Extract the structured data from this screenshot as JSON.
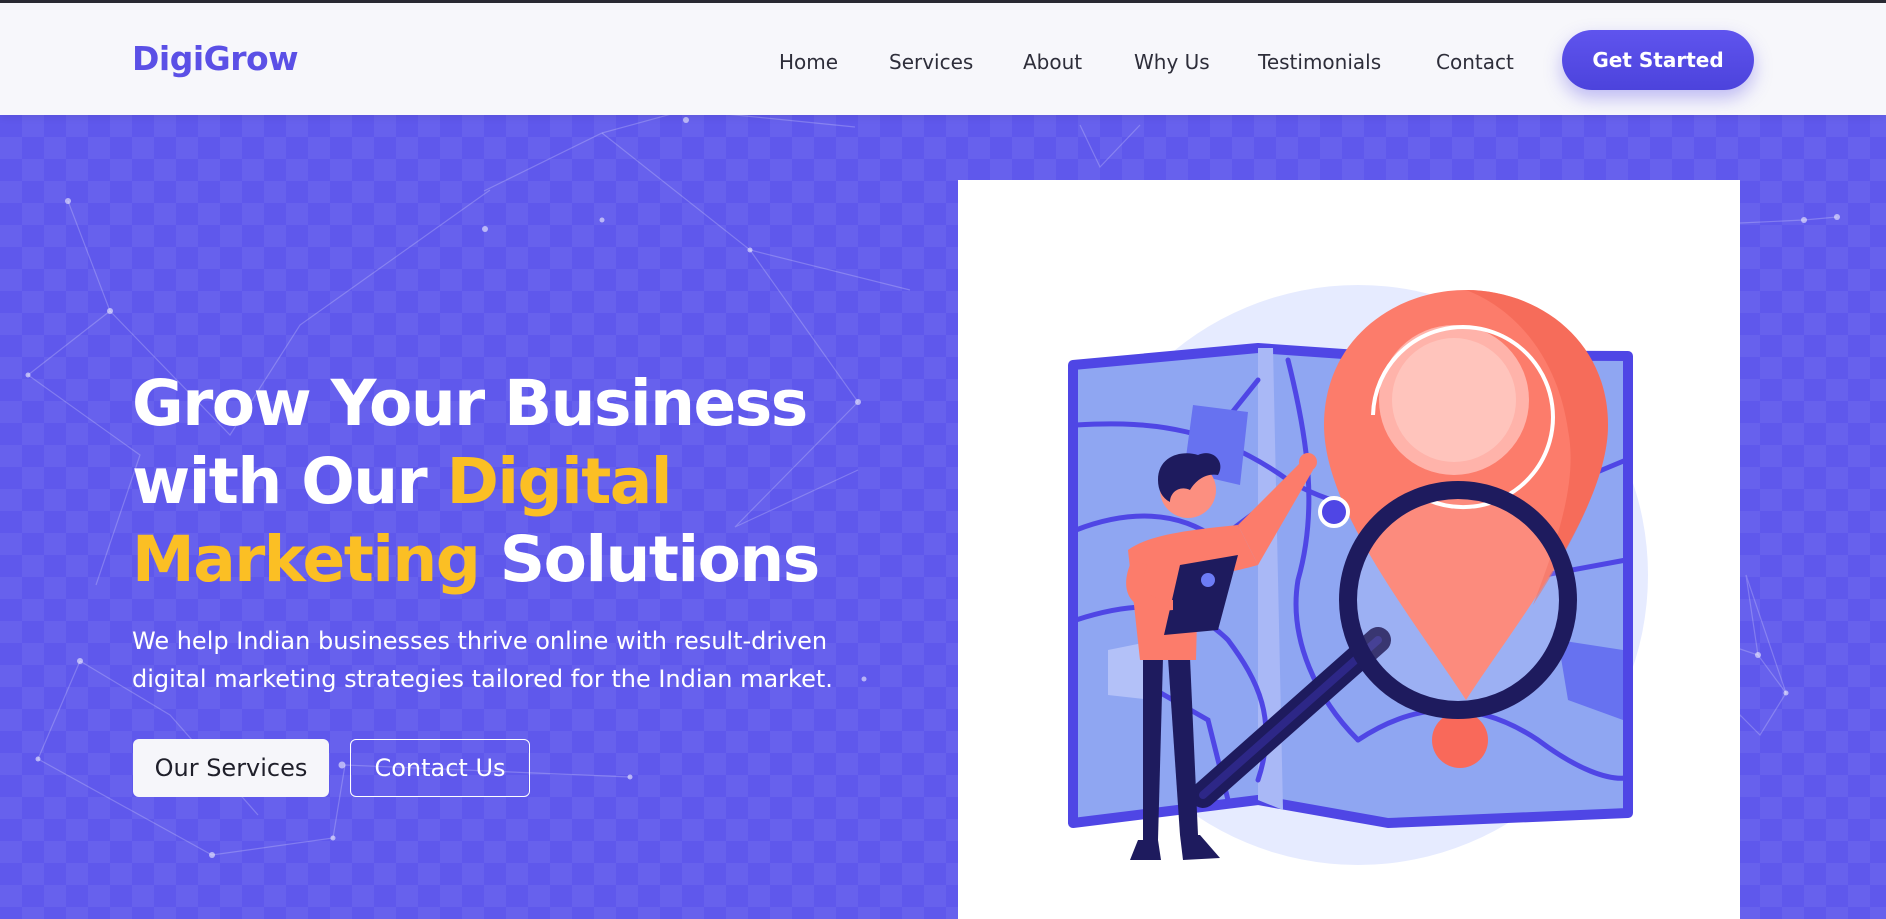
{
  "brand": {
    "name": "DigiGrow"
  },
  "nav": {
    "items": [
      {
        "label": "Home",
        "name": "nav-home"
      },
      {
        "label": "Services",
        "name": "nav-services"
      },
      {
        "label": "About",
        "name": "nav-about"
      },
      {
        "label": "Why Us",
        "name": "nav-why-us"
      },
      {
        "label": "Testimonials",
        "name": "nav-testimonials"
      },
      {
        "label": "Contact",
        "name": "nav-contact"
      }
    ],
    "cta_label": "Get Started"
  },
  "hero": {
    "title_part1": "Grow Your Business with Our ",
    "title_highlight": "Digital Marketing",
    "title_part2": " Solutions",
    "subtitle": "We help Indian businesses thrive online with result-driven digital marketing strategies tailored for the Indian market.",
    "primary_button": "Our Services",
    "secondary_button": "Contact Us",
    "illustration": "person-with-map-magnifier-location-pin"
  },
  "colors": {
    "accent": "#5b50e6",
    "hero_bg": "#5f58ec",
    "highlight": "#fbbf24",
    "pin": "#fc7c6b",
    "map": "#8fa6f2"
  }
}
